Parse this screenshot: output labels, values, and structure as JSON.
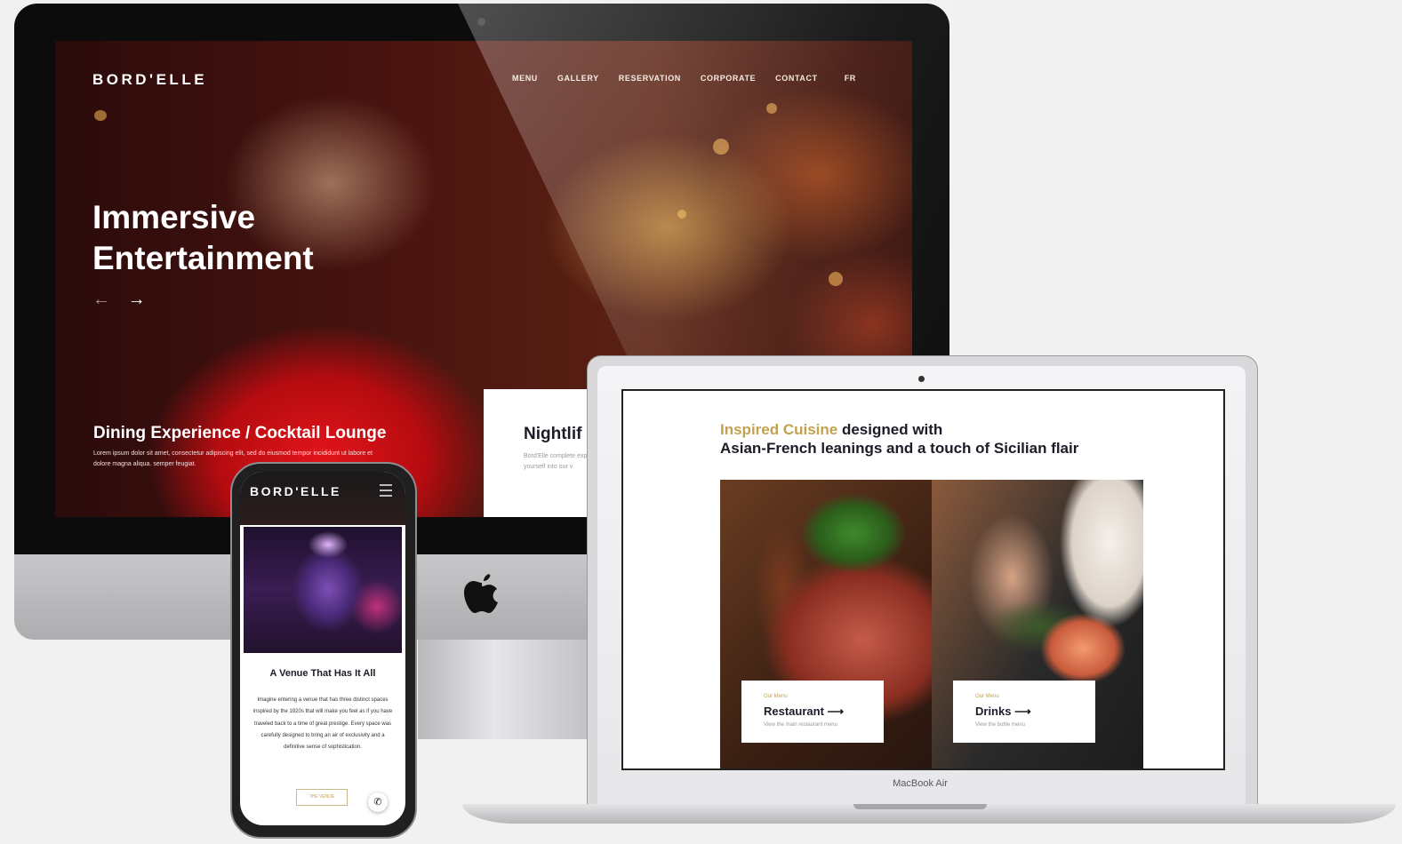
{
  "imac": {
    "brand": "BORD'ELLE",
    "nav": [
      "MENU",
      "GALLERY",
      "RESERVATION",
      "CORPORATE",
      "CONTACT",
      "FR"
    ],
    "hero_title_line1": "Immersive",
    "hero_title_line2": "Entertainment",
    "prev_arrow": "←",
    "next_arrow": "→",
    "subheading": "Dining Experience / Cocktail Lounge",
    "lorem": "Lorem ipsum dolor sit amet, consectetur adipiscing elit, sed do eiusmod tempor incididunt ut labore et dolore magna aliqua. semper feugiat.",
    "card_title": "Nightlif",
    "card_text": "Bord'Elle complete experience when t yourself into our v"
  },
  "macbook": {
    "label": "MacBook Air",
    "heading_gold": "Inspired Cuisine",
    "heading_rest": " designed with",
    "heading_line2": "Asian-French leanings and a touch of Sicilian flair",
    "tiles": [
      {
        "kicker": "Our Menu",
        "name": "Restaurant",
        "arrow": "⟶",
        "desc": "View the main restaurant menu"
      },
      {
        "kicker": "Our Menu",
        "name": "Drinks",
        "arrow": "⟶",
        "desc": "View the bottle menu"
      }
    ]
  },
  "phone": {
    "brand": "BORD'ELLE",
    "title": "A Venue That Has It All",
    "text": "Imagine entering a venue that has three distinct spaces inspired by the 1920s that will make you feel as if you have traveled back to a time of great prestige. Every space was carefully designed to bring an air of exclusivity and a definitive sense of sophistication.",
    "button": "THE VENUE",
    "call_icon": "✆"
  },
  "colors": {
    "gold": "#c3a14e",
    "dark": "#1c1c28",
    "hero_red": "#d01218"
  }
}
